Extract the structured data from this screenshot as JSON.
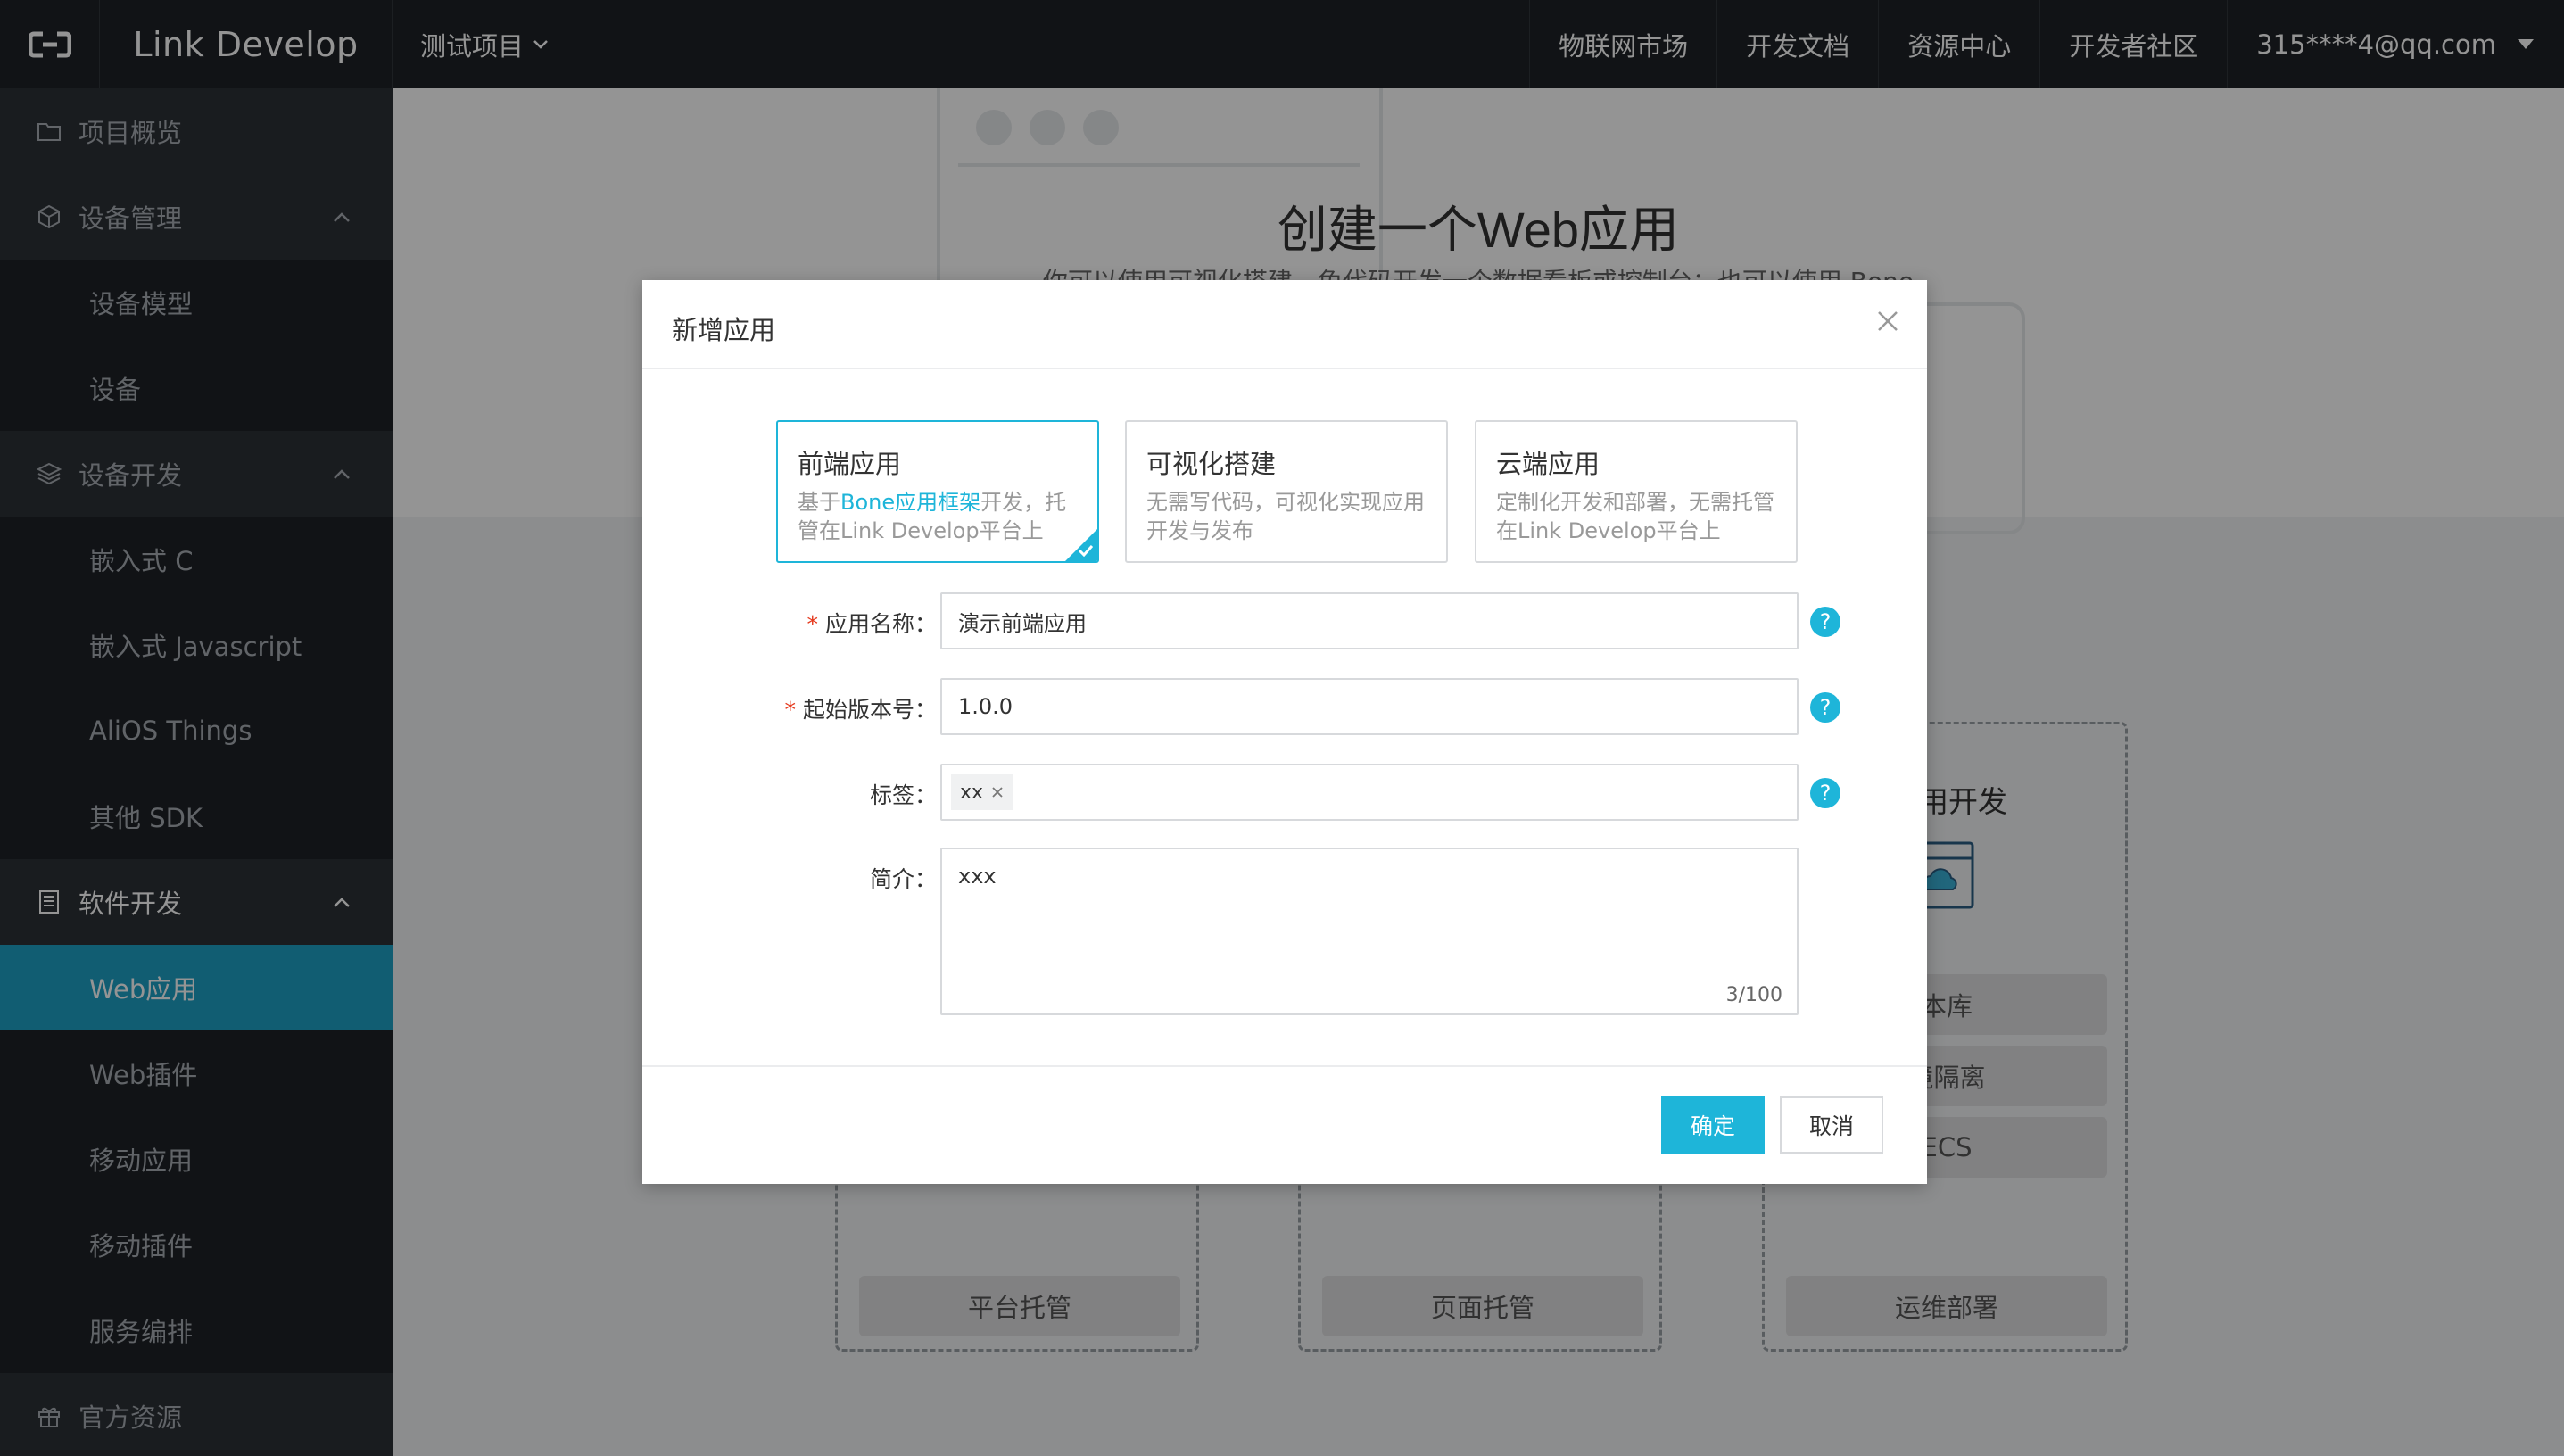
{
  "topbar": {
    "brand": "Link Develop",
    "project": "测试项目",
    "nav": [
      "物联网市场",
      "开发文档",
      "资源中心",
      "开发者社区"
    ],
    "user": "315****4@qq.com"
  },
  "sidebar": {
    "overview": "项目概览",
    "device_mgmt": "设备管理",
    "device_model": "设备模型",
    "device": "设备",
    "device_dev": "设备开发",
    "embedded_c": "嵌入式 C",
    "embedded_js": "嵌入式 Javascript",
    "alios": "AliOS Things",
    "other_sdk": "其他 SDK",
    "software_dev": "软件开发",
    "web_app": "Web应用",
    "web_plugin": "Web插件",
    "mobile_app": "移动应用",
    "mobile_plugin": "移动插件",
    "service_orch": "服务编排",
    "official": "官方资源"
  },
  "background": {
    "title": "创建一个Web应用",
    "subtitle": "你可以使用可视化搭建、免代码开发一个数据看板或控制台；也可以使用 Bone",
    "card3_title": "应用开发",
    "btn_platform": "平台托管",
    "btn_page": "页面托管",
    "btn_ops": "运维部署",
    "row_a": "本库",
    "row_b": "境隔离",
    "row_c": "ECS"
  },
  "dialog": {
    "title": "新增应用",
    "types": [
      {
        "title": "前端应用",
        "desc_pre": "基于",
        "desc_link": "Bone应用框架",
        "desc_post": "开发，托管在Link Develop平台上"
      },
      {
        "title": "可视化搭建",
        "desc": "无需写代码，可视化实现应用开发与发布"
      },
      {
        "title": "云端应用",
        "desc": "定制化开发和部署，无需托管在Link Develop平台上"
      }
    ],
    "fields": {
      "name_label": "应用名称：",
      "name_value": "演示前端应用",
      "version_label": "起始版本号：",
      "version_value": "1.0.0",
      "tags_label": "标签：",
      "tag_value": "xx",
      "intro_label": "简介：",
      "intro_value": "xxx",
      "intro_counter": "3/100",
      "required_mark": "*",
      "help_glyph": "?"
    },
    "ok": "确定",
    "cancel": "取消"
  },
  "colors": {
    "accent": "#1eb5d9",
    "active_menu": "#1ea0c5",
    "sidebar_bg": "#1e2226",
    "required": "#e5391d"
  }
}
